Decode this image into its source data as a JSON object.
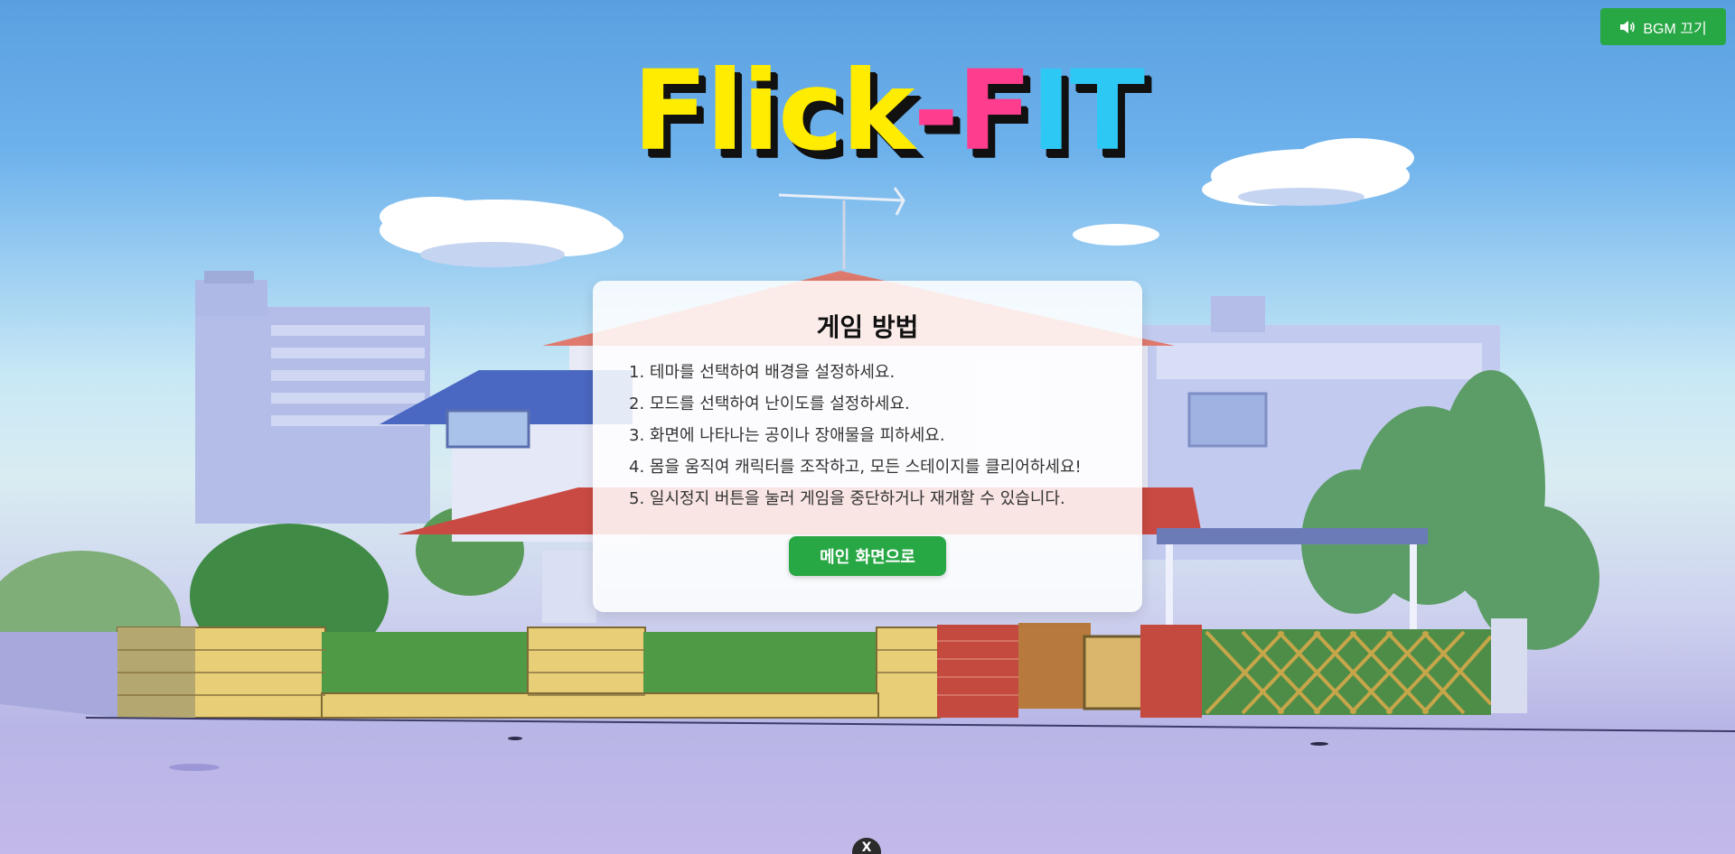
{
  "app": {
    "logo": {
      "letters": [
        {
          "char": "F",
          "color": "#ffec00"
        },
        {
          "char": "l",
          "color": "#ffec00"
        },
        {
          "char": "i",
          "color": "#ffec00"
        },
        {
          "char": "c",
          "color": "#ffec00"
        },
        {
          "char": "k",
          "color": "#ffec00"
        },
        {
          "char": "-",
          "color": "#ff3d8f"
        },
        {
          "char": "F",
          "color": "#ff3d8f"
        },
        {
          "char": "I",
          "color": "#2ec8f5"
        },
        {
          "char": "T",
          "color": "#2ec8f5"
        }
      ]
    }
  },
  "bgm_button": {
    "label": "BGM 끄기",
    "icon": "speaker-icon",
    "color": "#28a745"
  },
  "instructions": {
    "title": "게임 방법",
    "items": [
      "1. 테마를 선택하여 배경을 설정하세요.",
      "2. 모드를 선택하여 난이도를 설정하세요.",
      "3. 화면에 나타나는 공이나 장애물을 피하세요.",
      "4. 몸을 움직여 캐릭터를 조작하고, 모든 스테이지를 클리어하세요!",
      "5. 일시정지 버튼을 눌러 게임을 중단하거나 재개할 수 있습니다."
    ],
    "main_button_label": "메인 화면으로",
    "main_button_color": "#28a745"
  },
  "bottom_button": {
    "label": "X"
  },
  "background": {
    "description_icon": "anime-house-scene"
  }
}
